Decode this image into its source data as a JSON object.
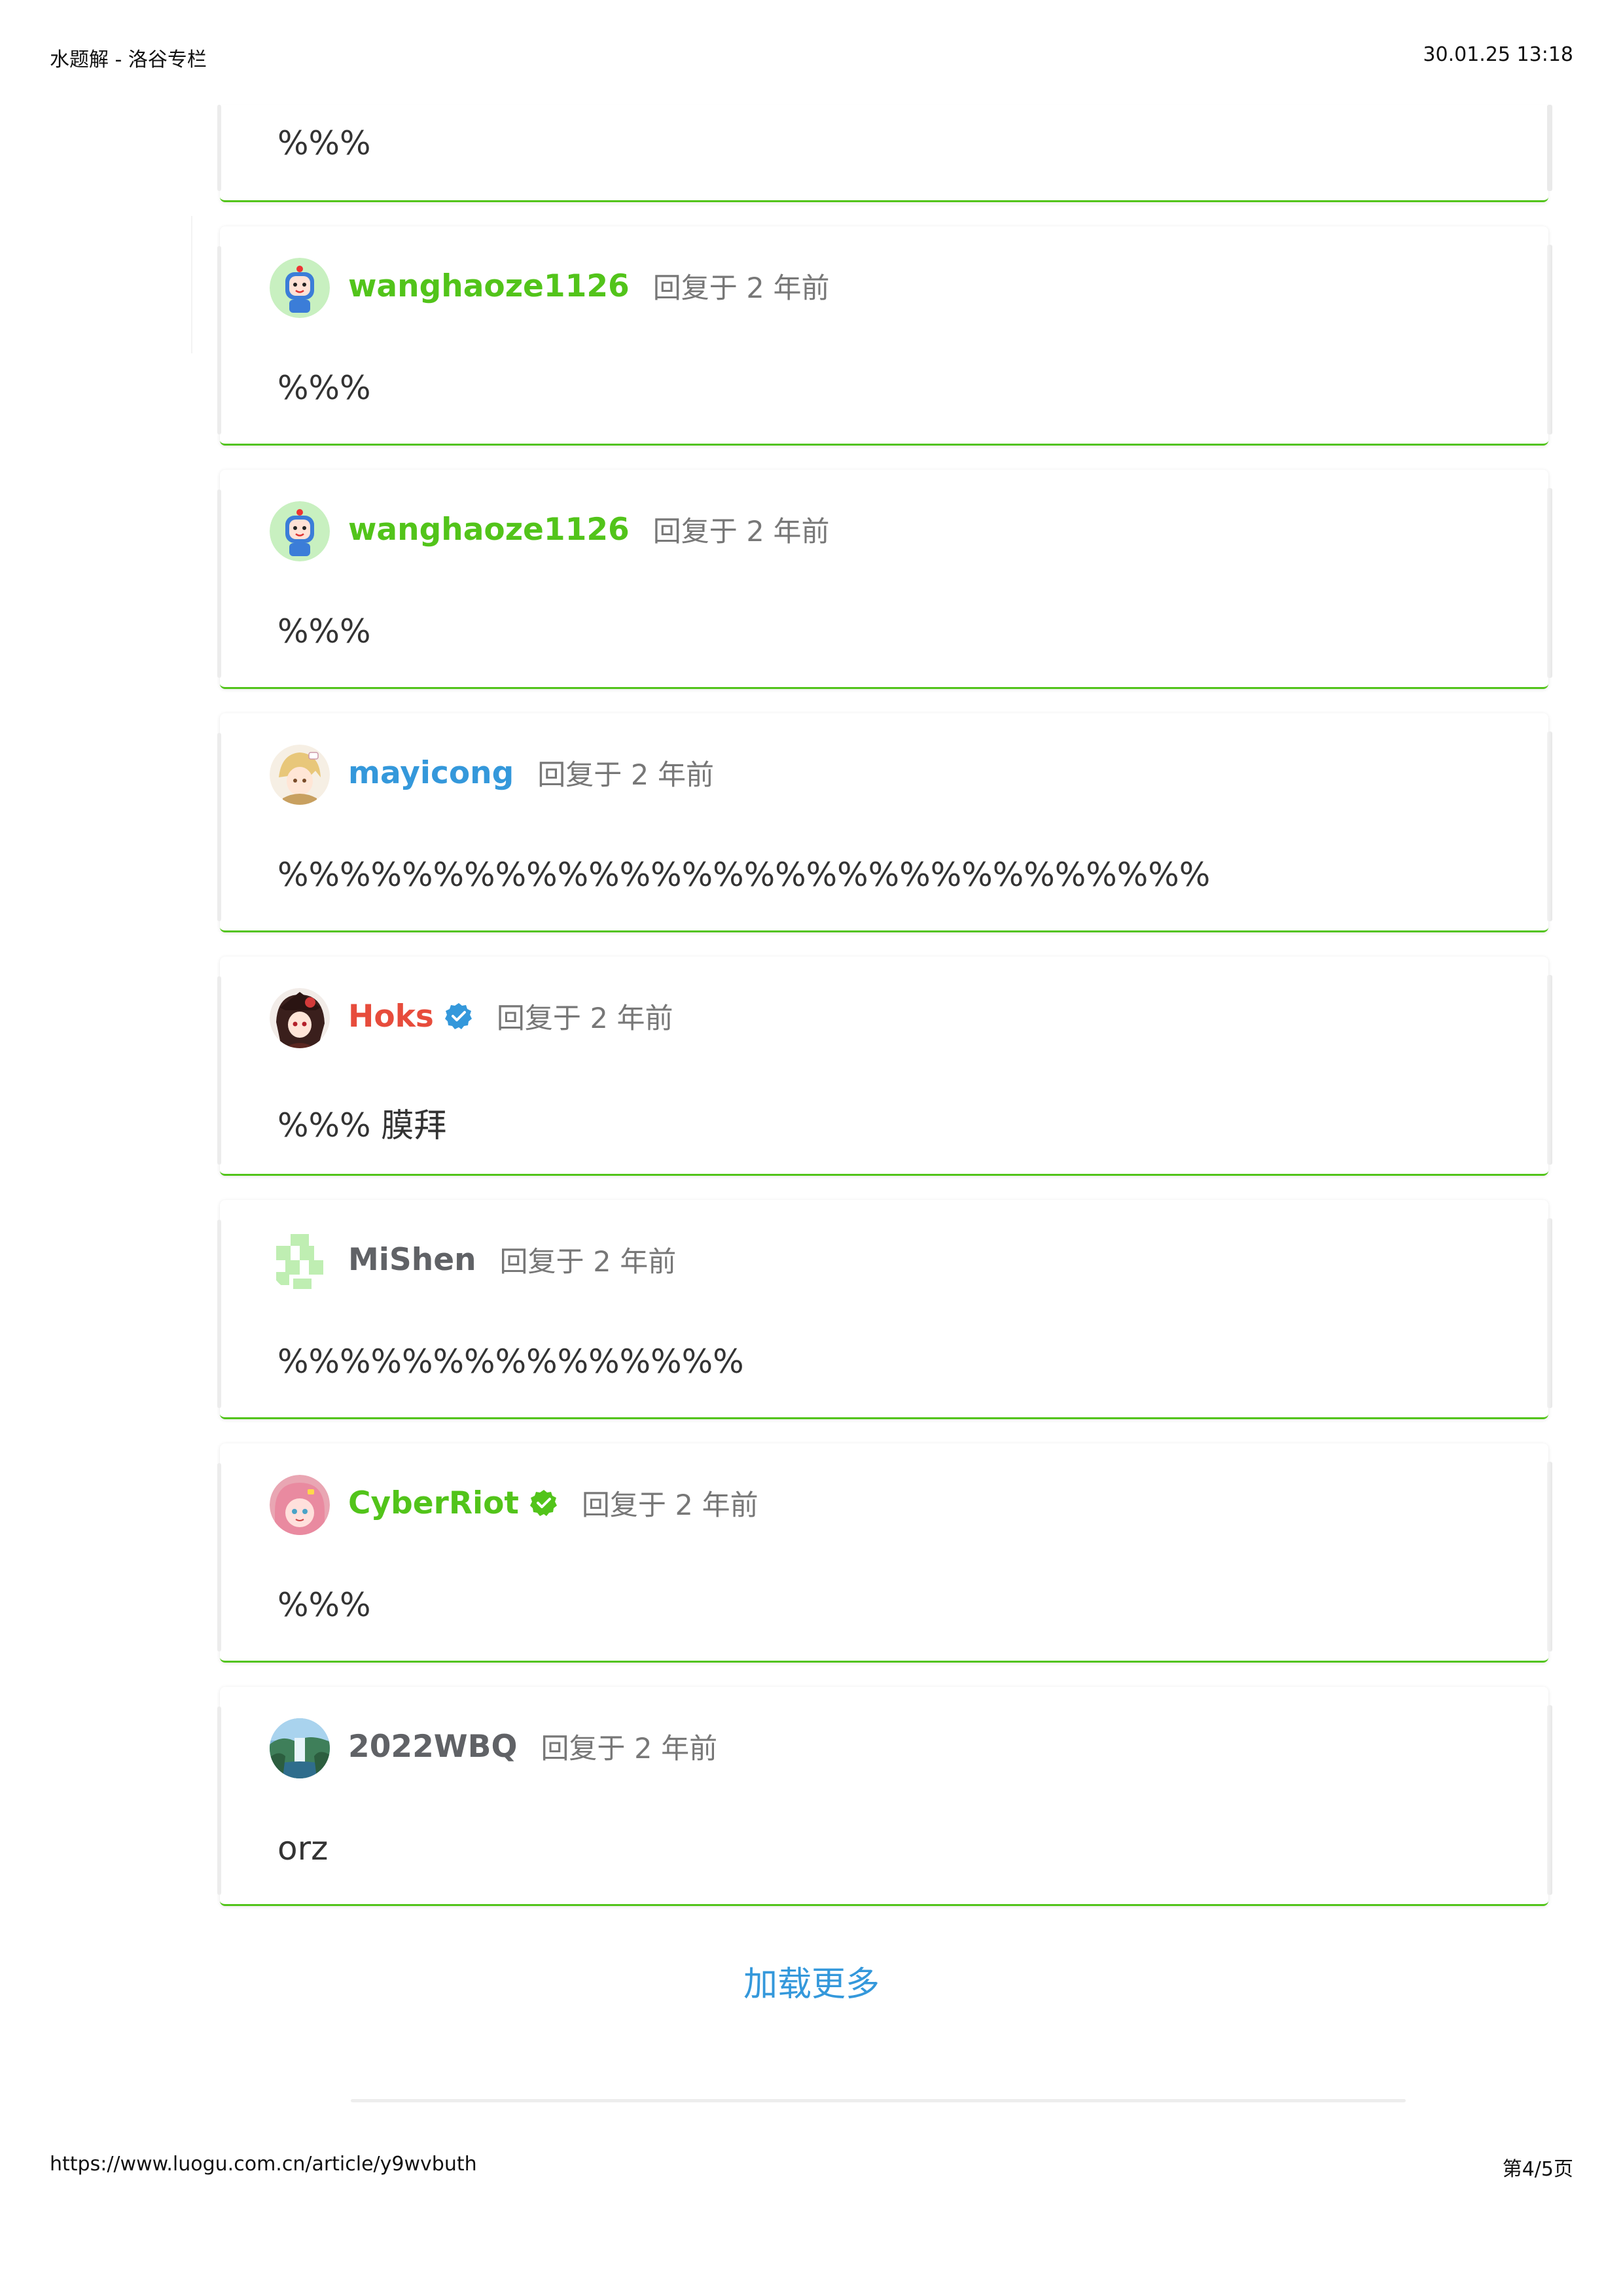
{
  "print_header": {
    "title": "水题解 - 洛谷专栏",
    "datetime": "30.01.25 13:18"
  },
  "print_footer": {
    "url": "https://www.luogu.com.cn/article/y9wvbuth",
    "page": "第4/5页"
  },
  "partial_comment": {
    "content": "%%%"
  },
  "comments": [
    {
      "user": "wanghaoze1126",
      "name_color": "#52c41a",
      "time": "回复于 2 年前",
      "content": "%%%",
      "avatar_icon": "robot-avatar-icon"
    },
    {
      "user": "wanghaoze1126",
      "name_color": "#52c41a",
      "time": "回复于 2 年前",
      "content": "%%%",
      "avatar_icon": "robot-avatar-icon"
    },
    {
      "user": "mayicong",
      "name_color": "#3498db",
      "time": "回复于 2 年前",
      "content": "%%%%%%%%%%%%%%%%%%%%%%%%%%%%%%",
      "avatar_icon": "anime-avatar-icon"
    },
    {
      "user": "Hoks",
      "name_color": "#e74c3c",
      "time": "回复于 2 年前",
      "content": "%%% 膜拜",
      "avatar_icon": "anime-avatar-icon",
      "badge": "blue-check-badge-icon"
    },
    {
      "user": "MiShen",
      "name_color": "#606266",
      "time": "回复于 2 年前",
      "content": "%%%%%%%%%%%%%%%",
      "avatar_icon": "identicon-avatar-icon"
    },
    {
      "user": "CyberRiot",
      "name_color": "#52c41a",
      "time": "回复于 2 年前",
      "content": "%%%",
      "avatar_icon": "anime-avatar-icon",
      "badge": "green-check-badge-icon"
    },
    {
      "user": "2022WBQ",
      "name_color": "#606266",
      "time": "回复于 2 年前",
      "content": "orz",
      "avatar_icon": "landscape-avatar-icon"
    }
  ],
  "load_more_label": "加载更多"
}
